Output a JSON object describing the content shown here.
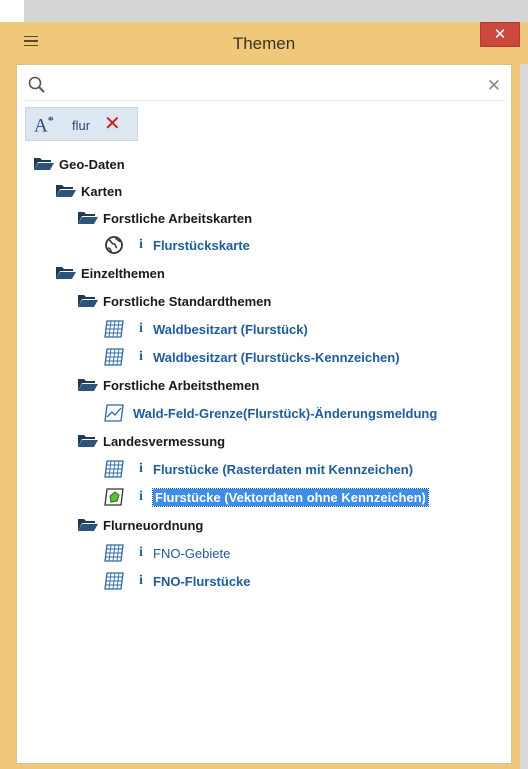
{
  "window": {
    "title": "Themen",
    "close_label": "✕"
  },
  "search": {
    "value": "",
    "placeholder": "",
    "clear_label": "✕"
  },
  "filter_chip": {
    "icon_text": "A",
    "icon_sup": "*",
    "text": "flur",
    "remove_label": "✕"
  },
  "tree": {
    "geo_daten": "Geo-Daten",
    "karten": "Karten",
    "forstliche_arbeitskarten": "Forstliche Arbeitskarten",
    "flurstueckskarte": "Flurstückskarte",
    "einzelthemen": "Einzelthemen",
    "forstliche_standardthemen": "Forstliche Standardthemen",
    "waldbesitzart_flurstueck": "Waldbesitzart (Flurstück)",
    "waldbesitzart_kennzeichen": "Waldbesitzart (Flurstücks-Kennzeichen)",
    "forstliche_arbeitsthemen": "Forstliche Arbeitsthemen",
    "wald_feld_grenze": "Wald-Feld-Grenze(Flurstück)-Änderungsmeldung",
    "landesvermessung": "Landesvermessung",
    "flurstuecke_raster": "Flurstücke (Rasterdaten mit Kennzeichen)",
    "flurstuecke_vektor": "Flurstücke (Vektordaten ohne Kennzeichen)",
    "flurneuordnung": "Flurneuordnung",
    "fno_gebiete": "FNO-Gebiete",
    "fno_flurstuecke": "FNO-Flurstücke",
    "info_label": "i"
  },
  "colors": {
    "title_bar": "#efc879",
    "selection": "#3d8ee8",
    "layer_text": "#1e5c9a",
    "close_button": "#c9493f"
  }
}
